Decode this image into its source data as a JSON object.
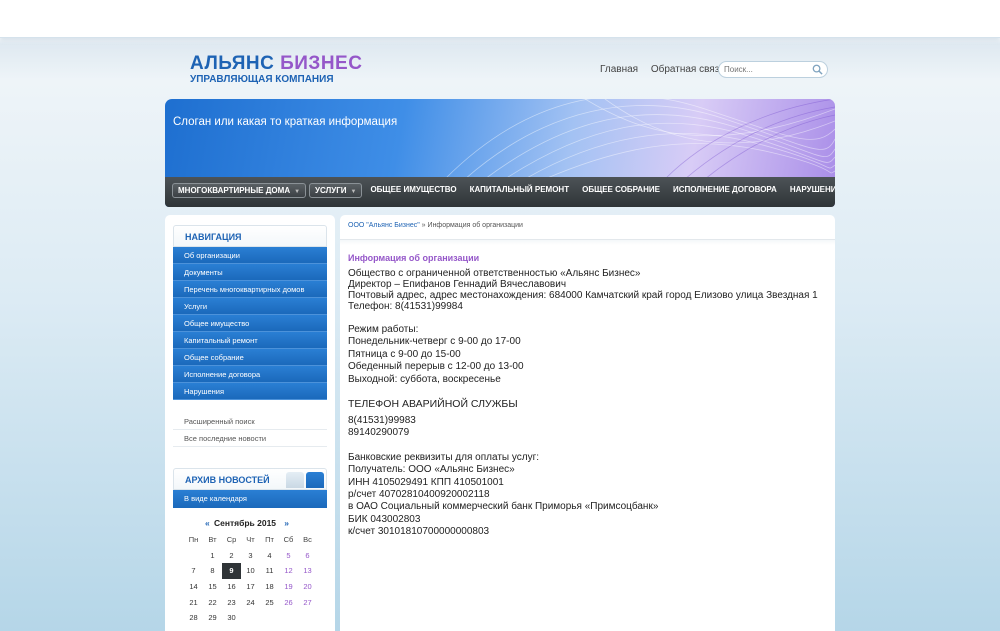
{
  "header": {
    "logo_part1": "АЛЬЯНС",
    "logo_part2": "БИЗНЕС",
    "logo_sub": "УПРАВЛЯЮЩАЯ КОМПАНИЯ",
    "links": [
      "Главная",
      "Обратная связь"
    ],
    "search_placeholder": "Поиск..."
  },
  "banner": {
    "slogan": "Слоган или какая то краткая информация"
  },
  "menu": [
    {
      "label": "МНОГОКВАРТИРНЫЕ ДОМА",
      "dropdown": true
    },
    {
      "label": "УСЛУГИ",
      "dropdown": true
    },
    {
      "label": "ОБЩЕЕ ИМУЩЕСТВО"
    },
    {
      "label": "КАПИТАЛЬНЫЙ РЕМОНТ"
    },
    {
      "label": "ОБЩЕЕ СОБРАНИЕ"
    },
    {
      "label": "ИСПОЛНЕНИЕ ДОГОВОРА"
    },
    {
      "label": "НАРУШЕНИЯ"
    }
  ],
  "sidebar": {
    "nav_title": "НАВИГАЦИЯ",
    "nav_items": [
      "Об организации",
      "Документы",
      "Перечень многоквартирных домов",
      "Услуги",
      "Общее имущество",
      "Капитальный ремонт",
      "Общее собрание",
      "Исполнение договора",
      "Нарушения"
    ],
    "sub_links": [
      "Расширенный поиск",
      "Все последние новости"
    ],
    "archive_title": "АРХИВ НОВОСТЕЙ",
    "archive_calendar": "В виде календаря",
    "calendar": {
      "month": "Сентябрь 2015",
      "prev": "«",
      "next": "»",
      "weekdays": [
        "Пн",
        "Вт",
        "Ср",
        "Чт",
        "Пт",
        "Сб",
        "Вс"
      ],
      "weeks": [
        [
          "",
          "1",
          "2",
          "3",
          "4",
          "5",
          "6"
        ],
        [
          "7",
          "8",
          "9",
          "10",
          "11",
          "12",
          "13"
        ],
        [
          "14",
          "15",
          "16",
          "17",
          "18",
          "19",
          "20"
        ],
        [
          "21",
          "22",
          "23",
          "24",
          "25",
          "26",
          "27"
        ],
        [
          "28",
          "29",
          "30",
          "",
          "",
          "",
          ""
        ]
      ],
      "today": "9"
    }
  },
  "content": {
    "breadcrumb_link": "ООО \"Альянс Бизнес\"",
    "breadcrumb_sep": " » ",
    "breadcrumb_current": "Информация об организации",
    "title": "Информация об организации",
    "org_lines": [
      "Общество с ограниченной ответственностью «Альянс Бизнес»",
      "Директор – Епифанов Геннадий Вячеславович",
      "Почтовый адрес, адрес местонахождения: 684000 Камчатский край город Елизово улица Звездная 1",
      "Телефон: 8(41531)99984"
    ],
    "schedule_lines": [
      "Режим работы:",
      "Понедельник-четверг с 9-00 до 17-00",
      "Пятница с 9-00 до 15-00",
      "Обеденный перерыв с 12-00 до 13-00",
      "Выходной: суббота, воскресенье"
    ],
    "emergency_title": "ТЕЛЕФОН АВАРИЙНОЙ СЛУЖБЫ",
    "emergency_lines": [
      "8(41531)99983",
      "89140290079"
    ],
    "bank_lines": [
      "Банковские реквизиты для оплаты услуг:",
      "Получатель: ООО «Альянс Бизнес»",
      "ИНН 4105029491 КПП 410501001",
      "р/счет 40702810400920002118",
      "в ОАО Социальный коммерческий банк Приморья «Примсоцбанк»",
      "БИК 043002803",
      "к/счет 30101810700000000803"
    ]
  }
}
